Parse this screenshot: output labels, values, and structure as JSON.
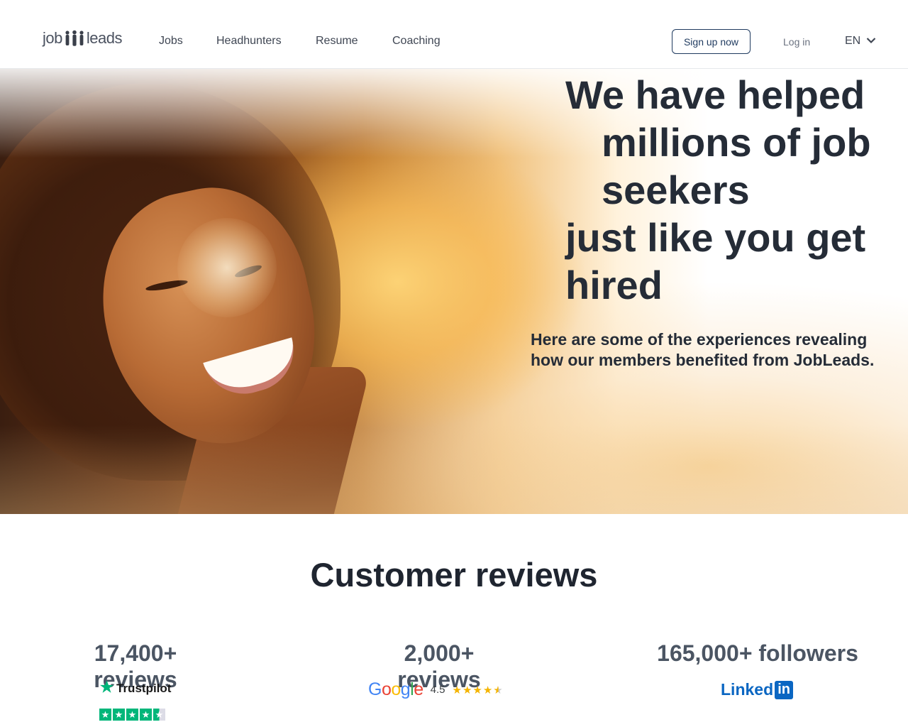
{
  "header": {
    "logo": {
      "left": "job",
      "right": "leads"
    },
    "nav": [
      "Jobs",
      "Headhunters",
      "Resume",
      "Coaching"
    ],
    "signup_label": "Sign up now",
    "login_label": "Log in",
    "language": "EN"
  },
  "hero": {
    "title_lines": [
      "We have helped",
      "millions of job",
      "seekers",
      "just like you get",
      "hired"
    ],
    "subtitle": "Here are some of the experiences revealing how our members benefited from JobLeads."
  },
  "reviews": {
    "title": "Customer reviews",
    "stats": [
      {
        "count": "17,400+ reviews",
        "platform": "Trustpilot",
        "stars": 4.5
      },
      {
        "count": "2,000+ reviews",
        "platform": "Google",
        "rating": "4.5",
        "stars": 4.5
      },
      {
        "count": "165,000+ followers",
        "platform": "LinkedIn",
        "brand_left": "Linked",
        "brand_right": "in"
      }
    ]
  },
  "colors": {
    "text_dark": "#252c37",
    "signup_border": "#1f3a5f",
    "trustpilot_green": "#00b67a",
    "google_star": "#f4b400",
    "linkedin_blue": "#0a66c2"
  }
}
